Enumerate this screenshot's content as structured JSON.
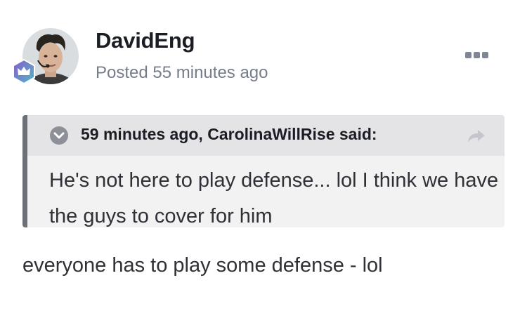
{
  "post": {
    "author": "DavidEng",
    "posted": "Posted 55 minutes ago",
    "content": "everyone has to play some defense - lol"
  },
  "avatar": {
    "icon": "user-avatar-photo",
    "badge_icon": "crown-icon",
    "badge_colors": [
      "#8a5cc8",
      "#4fb7c9"
    ]
  },
  "menu": {
    "icon": "more-options-icon"
  },
  "quote": {
    "citation": "59 minutes ago, CarolinaWillRise said:",
    "body": "He's not here to play defense... lol I think we have the guys to cover for him",
    "toggle_icon": "chevron-down-icon",
    "jump_icon": "share-arrow-icon"
  },
  "colors": {
    "text_primary": "#1b1d24",
    "text_muted": "#757c8c",
    "quote_bg": "#f2f2f3",
    "quote_header_bg": "#e4e4e6",
    "quote_border": "#6e7077"
  }
}
